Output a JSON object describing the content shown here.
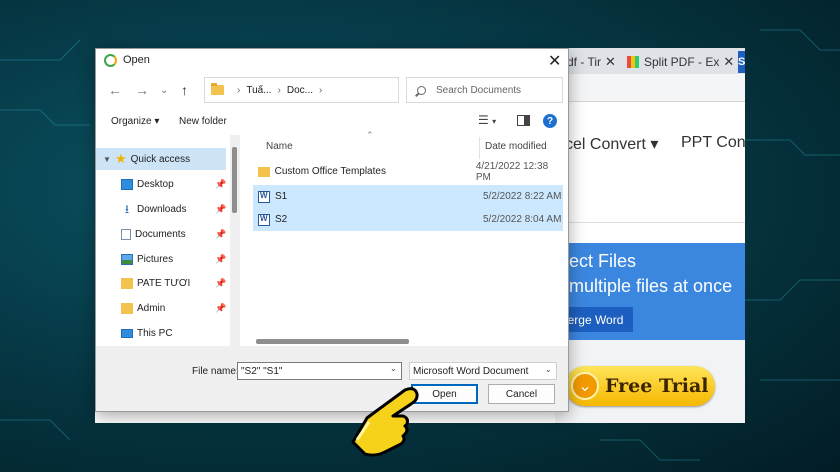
{
  "browser": {
    "tabs": [
      {
        "label": "df - Tir",
        "close": "✕"
      },
      {
        "label": "Split PDF - Ex",
        "close": "✕"
      }
    ],
    "tab_partial": "S",
    "nav": [
      "cel Convert ▾",
      "PPT Conv"
    ],
    "hero_title": "ect Files",
    "hero_subtitle": "multiple files at once",
    "hero_button": "erge Word",
    "trial_button": "Free Trial"
  },
  "dialog": {
    "title": "Open",
    "close": "✕",
    "path": {
      "crumbs": [
        "Tuấ...",
        "Doc..."
      ]
    },
    "search_placeholder": "Search Documents",
    "toolbar": {
      "organize": "Organize ▾",
      "new_folder": "New folder"
    },
    "nav_items": [
      {
        "label": "Quick access",
        "icon": "star-icon"
      },
      {
        "label": "Desktop",
        "icon": "desktop-icon"
      },
      {
        "label": "Downloads",
        "icon": "download-icon"
      },
      {
        "label": "Documents",
        "icon": "documents-icon"
      },
      {
        "label": "Pictures",
        "icon": "pictures-icon"
      },
      {
        "label": "PATE TƯƠI",
        "icon": "folder-icon"
      },
      {
        "label": "Admin",
        "icon": "folder-icon"
      },
      {
        "label": "This PC",
        "icon": "monitor-icon"
      }
    ],
    "columns": {
      "name": "Name",
      "date": "Date modified"
    },
    "files": [
      {
        "name": "Custom Office Templates",
        "date": "4/21/2022 12:38 PM",
        "type": "folder"
      },
      {
        "name": "S1",
        "date": "5/2/2022 8:22 AM",
        "type": "word"
      },
      {
        "name": "S2",
        "date": "5/2/2022 8:04 AM",
        "type": "word"
      }
    ],
    "file_name_label": "File name:",
    "file_name_value": "\"S2\" \"S1\"",
    "file_type": "Microsoft Word Document",
    "open_button": "Open",
    "cancel_button": "Cancel"
  },
  "colors": {
    "accent": "#0067c0",
    "selection": "#cce8ff",
    "hero": "#3b87e0"
  }
}
